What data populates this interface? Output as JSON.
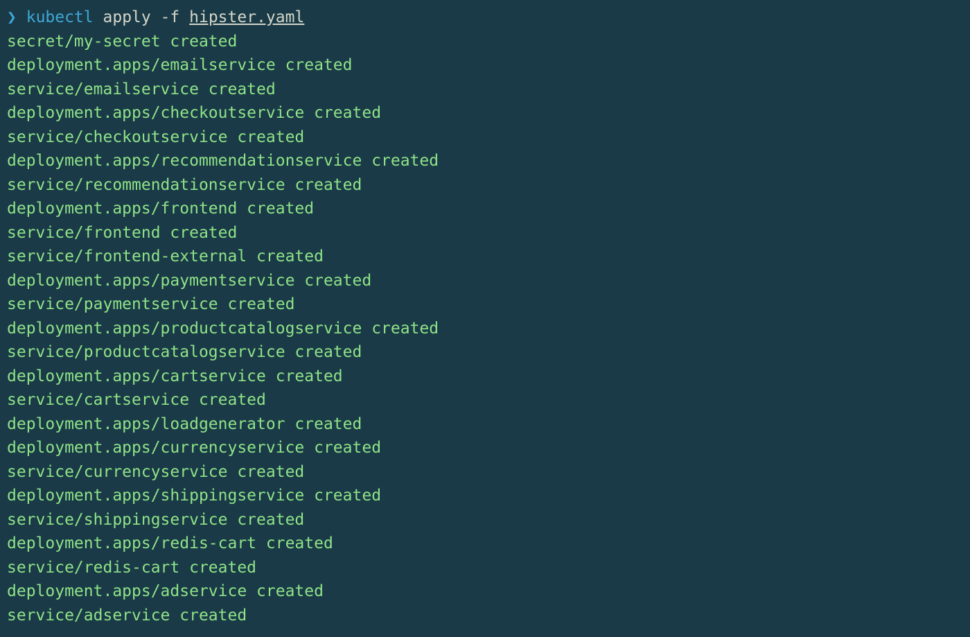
{
  "prompt": {
    "char": "❯",
    "command_part1": "kubectl",
    "command_part2": " apply -f ",
    "filename": "hipster.yaml"
  },
  "output_lines": [
    "secret/my-secret created",
    "deployment.apps/emailservice created",
    "service/emailservice created",
    "deployment.apps/checkoutservice created",
    "service/checkoutservice created",
    "deployment.apps/recommendationservice created",
    "service/recommendationservice created",
    "deployment.apps/frontend created",
    "service/frontend created",
    "service/frontend-external created",
    "deployment.apps/paymentservice created",
    "service/paymentservice created",
    "deployment.apps/productcatalogservice created",
    "service/productcatalogservice created",
    "deployment.apps/cartservice created",
    "service/cartservice created",
    "deployment.apps/loadgenerator created",
    "deployment.apps/currencyservice created",
    "service/currencyservice created",
    "deployment.apps/shippingservice created",
    "service/shippingservice created",
    "deployment.apps/redis-cart created",
    "service/redis-cart created",
    "deployment.apps/adservice created",
    "service/adservice created"
  ]
}
